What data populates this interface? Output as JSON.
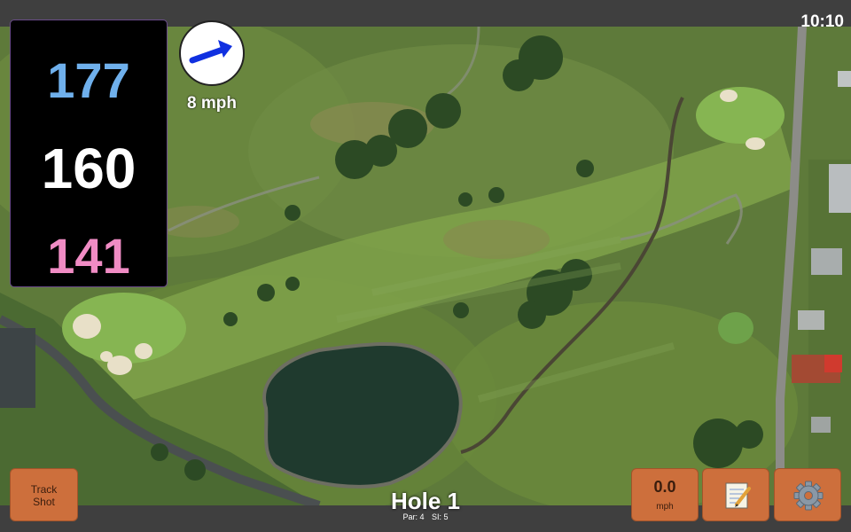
{
  "status_bar": {
    "time": "10:10"
  },
  "distances": {
    "back": "177",
    "middle": "160",
    "front": "141",
    "colors": {
      "back": "#6fb0ec",
      "middle": "#ffffff",
      "front": "#f08cc4"
    }
  },
  "wind": {
    "speed": "8 mph",
    "icon": "wind-direction-arrow",
    "arrow_color": "#1030e0",
    "text_color": "#ffffff"
  },
  "hole": {
    "title": "Hole 1",
    "par": "Par: 4",
    "si": "SI: 5"
  },
  "buttons": {
    "track_shot_line1": "Track",
    "track_shot_line2": "Shot",
    "speed_value": "0.0",
    "speed_unit": "mph",
    "notes_icon": "notepad-icon",
    "settings_icon": "gear-icon",
    "button_color": "#cd6f3c"
  },
  "map": {
    "type": "satellite-aerial-golf-hole"
  }
}
